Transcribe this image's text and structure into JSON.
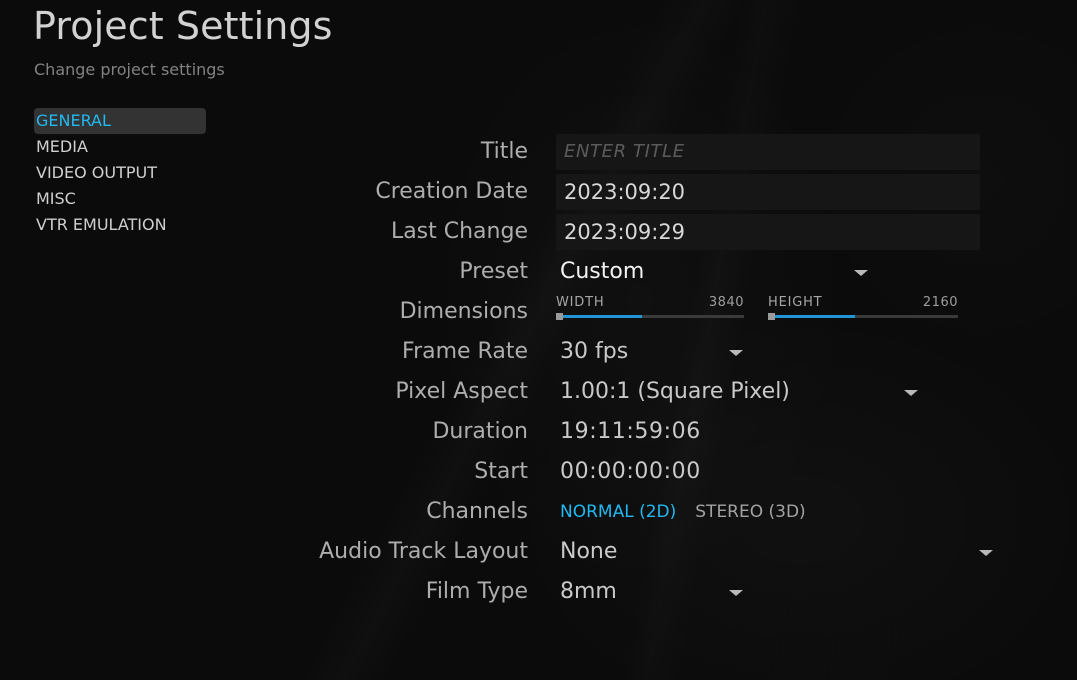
{
  "header": {
    "title": "Project Settings",
    "subtitle": "Change project settings"
  },
  "sidebar": {
    "items": [
      {
        "label": "GENERAL",
        "active": true
      },
      {
        "label": "MEDIA",
        "active": false
      },
      {
        "label": "VIDEO OUTPUT",
        "active": false
      },
      {
        "label": "MISC",
        "active": false
      },
      {
        "label": "VTR EMULATION",
        "active": false
      }
    ]
  },
  "form": {
    "title": {
      "label": "Title",
      "value": "",
      "placeholder": "ENTER TITLE"
    },
    "creation_date": {
      "label": "Creation Date",
      "value": "2023:09:20"
    },
    "last_change": {
      "label": "Last Change",
      "value": "2023:09:29"
    },
    "preset": {
      "label": "Preset",
      "value": "Custom"
    },
    "dimensions": {
      "label": "Dimensions",
      "width": {
        "name": "WIDTH",
        "value": "3840",
        "fill_percent": 46
      },
      "height": {
        "name": "HEIGHT",
        "value": "2160",
        "fill_percent": 46
      }
    },
    "frame_rate": {
      "label": "Frame Rate",
      "value": "30 fps"
    },
    "pixel_aspect": {
      "label": "Pixel Aspect",
      "value": "1.00:1 (Square Pixel)"
    },
    "duration": {
      "label": "Duration",
      "value": "19:11:59:06"
    },
    "start": {
      "label": "Start",
      "value": "00:00:00:00"
    },
    "channels": {
      "label": "Channels",
      "normal": "NORMAL (2D)",
      "stereo": "STEREO (3D)",
      "selected": "NORMAL (2D)"
    },
    "audio_track_layout": {
      "label": "Audio Track Layout",
      "value": "None"
    },
    "film_type": {
      "label": "Film Type",
      "value": "8mm"
    }
  },
  "colors": {
    "accent": "#21b9f0",
    "slider_fill": "#2196d6",
    "background": "#0b0b0b",
    "input_background": "#161616",
    "active_item_background": "#333333",
    "label_text": "#adadad",
    "value_text": "#c9c9c9"
  }
}
